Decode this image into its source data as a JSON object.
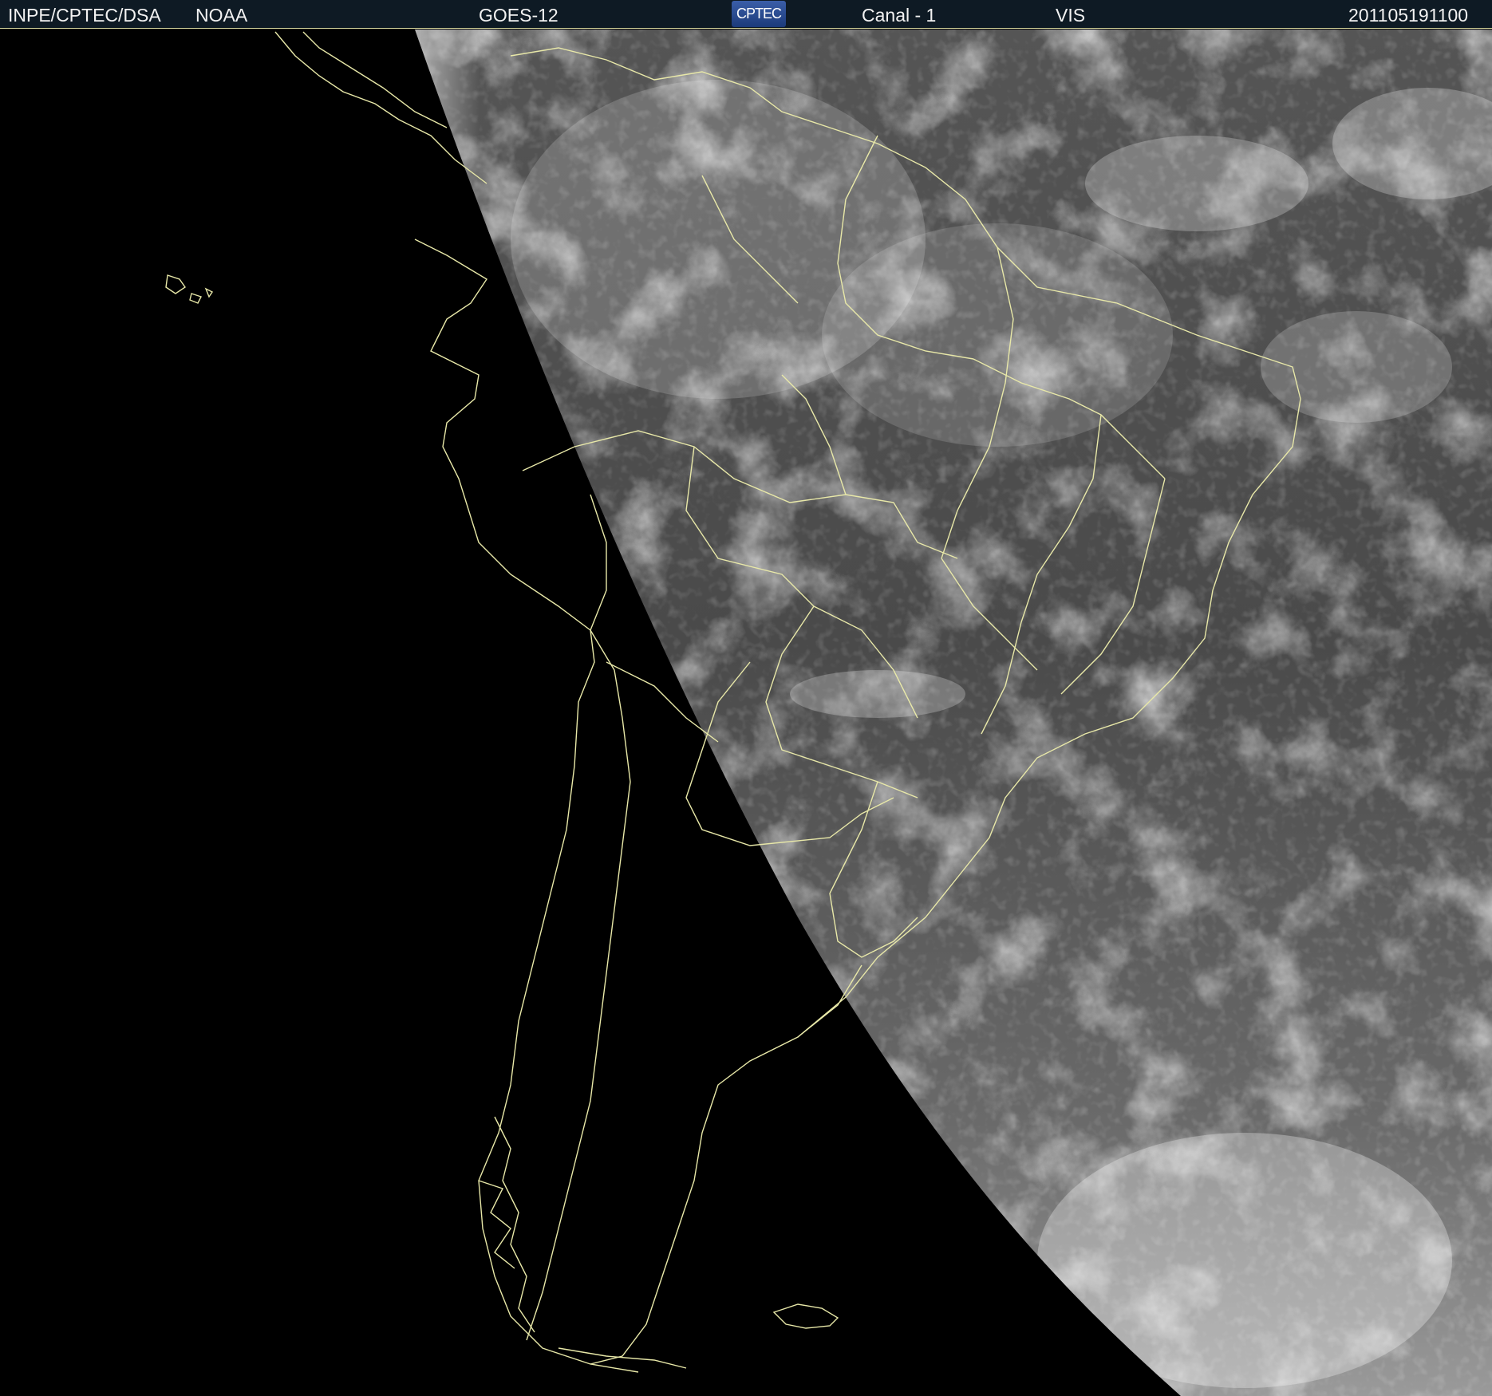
{
  "header": {
    "agency": "INPE/CPTEC/DSA",
    "operator": "NOAA",
    "satellite": "GOES-12",
    "logo_text": "CPTEC",
    "channel": "Canal - 1",
    "band": "VIS",
    "timestamp": "201105191100"
  },
  "colors": {
    "header_bg": "#0e1a24",
    "boundary_line": "#e8e8a8",
    "space": "#000000",
    "earth_disk": "#5a5a5a"
  },
  "icons": {
    "logo": "cptec-logo"
  }
}
